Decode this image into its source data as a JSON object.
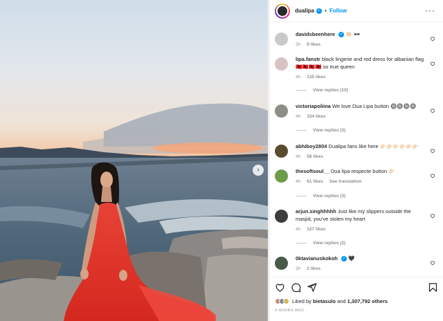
{
  "post": {
    "username": "dualipa",
    "follow_label": "Follow",
    "dot": "•"
  },
  "comments": [
    {
      "user": "davidsbeenhere",
      "text": "👏🏻 🕶",
      "time": "2h",
      "likes": "9 likes",
      "avatar_color": "#c9c9c9"
    },
    {
      "user": "lipa.fanstr",
      "text": "black lingerie and red dress for albanian flag 🇦🇱🇦🇱🇦🇱🇦🇱 so true queen",
      "time": "4h",
      "likes": "135 likes",
      "replies": "View replies (10)",
      "avatar_color": "#d8c2c2"
    },
    {
      "user": "victoriapoliina",
      "text": "We love Dua Lipa button 🔘🔘🔘🔘",
      "time": "4h",
      "likes": "154 likes",
      "replies": "View replies (3)",
      "avatar_color": "#8d8f86"
    },
    {
      "user": "abhiboy2804",
      "text": "Dualipa fans like here 👉🏻👉🏻👉🏻👉🏻👉🏻👉🏻",
      "time": "4h",
      "likes": "58 likes",
      "avatar_color": "#5a4b2e"
    },
    {
      "user": "thesoftsoul__",
      "text": "Dua lipa respecte button 👉🏻",
      "time": "4h",
      "likes": "61 likes",
      "translate": "See translation",
      "replies": "View replies (3)",
      "avatar_color": "#6e9c4b"
    },
    {
      "user": "arjun.singhhhhh",
      "text": "Just like my slippers outside the masjid, you've stolen my heart",
      "time": "4h",
      "likes": "127 likes",
      "replies": "View replies (2)",
      "avatar_color": "#3d3d3d"
    },
    {
      "user": "0ktavianuskokoh",
      "text": "🖤",
      "time": "2h",
      "likes": "2 likes",
      "avatar_color": "#4a5a4a"
    }
  ],
  "likes_line": {
    "prefix": "Liked by",
    "user": "bietasulo",
    "and": "and",
    "count": "1,307,792 others"
  },
  "time_ago": "4 HOURS AGO",
  "icons": {
    "heart": "heart-icon",
    "comment": "comment-icon",
    "share": "share-icon",
    "save": "bookmark-icon",
    "more": "more-options-icon",
    "next": "chevron-right-icon"
  },
  "colors": {
    "accent": "#0095f6",
    "dress": "#e8372f"
  }
}
